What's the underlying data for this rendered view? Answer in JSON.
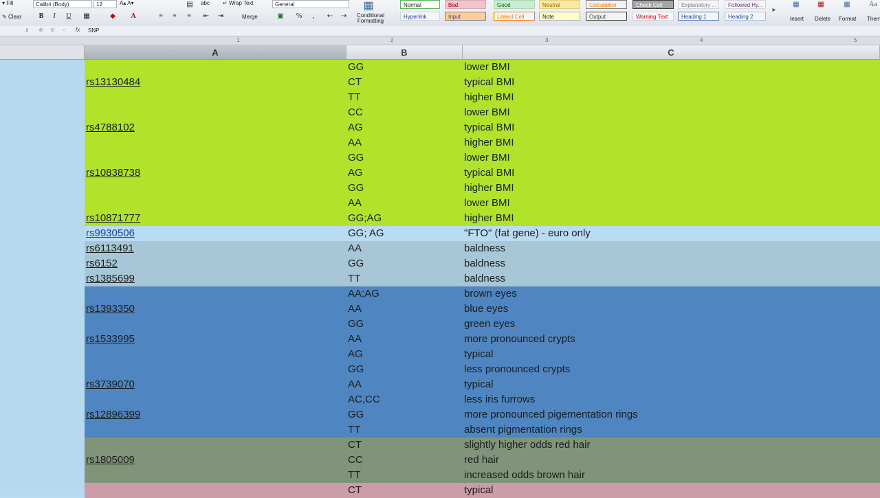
{
  "ribbon": {
    "fill_label": "Fill",
    "clear_label": "Clear",
    "font_name": "Calibri (Body)",
    "font_size": "12",
    "bold": "B",
    "italic": "I",
    "underline": "U",
    "wrap_text": "Wrap Text",
    "abc": "abc",
    "merge": "Merge",
    "number_format": "General",
    "percent": "%",
    "comma": ",",
    "conditional_formatting": "Conditional Formatting",
    "styles": [
      {
        "label": "Normal",
        "bg": "#ffffff",
        "fg": "#222222",
        "border": "#5ab55a"
      },
      {
        "label": "Bad",
        "bg": "#f2c4ce",
        "fg": "#9c0006",
        "border": "#d8a7b1"
      },
      {
        "label": "Good",
        "bg": "#c8eecf",
        "fg": "#006100",
        "border": "#a7d6b0"
      },
      {
        "label": "Neutral",
        "bg": "#fbeaa2",
        "fg": "#9c6500",
        "border": "#dfcf8a"
      },
      {
        "label": "Calculation",
        "bg": "#f2f2f2",
        "fg": "#fa7d00",
        "border": "#7f7f7f"
      },
      {
        "label": "Check Cell",
        "bg": "#a5a5a5",
        "fg": "#ffffff",
        "border": "#3f3f3f"
      },
      {
        "label": "Explanatory ...",
        "bg": "#f4f6f9",
        "fg": "#7f7f7f",
        "border": "#d0d5db"
      },
      {
        "label": "Followed Hy...",
        "bg": "#f4f6f9",
        "fg": "#7b2a90",
        "border": "#d0d5db"
      },
      {
        "label": "Hyperlink",
        "bg": "#f4f6f9",
        "fg": "#1f3bb8",
        "border": "#d0d5db"
      },
      {
        "label": "Input",
        "bg": "#ffcc99",
        "fg": "#3f3f76",
        "border": "#7f7f7f"
      },
      {
        "label": "Linked Cell",
        "bg": "#f4f6f9",
        "fg": "#fa7d00",
        "border": "#fa7d00"
      },
      {
        "label": "Note",
        "bg": "#ffffcc",
        "fg": "#222222",
        "border": "#b2b2b2"
      },
      {
        "label": "Output",
        "bg": "#f2f2f2",
        "fg": "#3f3f3f",
        "border": "#3f3f3f"
      },
      {
        "label": "Warning Text",
        "bg": "#f4f6f9",
        "fg": "#ff0000",
        "border": "#d0d5db"
      },
      {
        "label": "Heading 1",
        "bg": "#f4f6f9",
        "fg": "#1f497d",
        "border": "#4f81bd"
      },
      {
        "label": "Heading 2",
        "bg": "#f4f6f9",
        "fg": "#1f497d",
        "border": "#a7bfde"
      }
    ],
    "insert": "Insert",
    "delete": "Delete",
    "format": "Format",
    "themes": "Them"
  },
  "formula_bar": {
    "fx": "fx",
    "value": "SNP"
  },
  "ruler_marks": [
    "1",
    "2",
    "3",
    "4",
    "5"
  ],
  "columns": [
    "A",
    "B",
    "C"
  ],
  "rows": [
    {
      "a": "",
      "b": "GG",
      "c": "lower BMI",
      "bg": "#b2e32b"
    },
    {
      "a": "rs13130484",
      "b": "CT",
      "c": "typical BMI",
      "bg": "#b2e32b"
    },
    {
      "a": "",
      "b": "TT",
      "c": "higher BMI",
      "bg": "#b2e32b"
    },
    {
      "a": "",
      "b": "CC",
      "c": "lower BMI",
      "bg": "#b2e32b"
    },
    {
      "a": "rs4788102",
      "b": "AG",
      "c": "typical BMI",
      "bg": "#b2e32b"
    },
    {
      "a": "",
      "b": "AA",
      "c": "higher BMI",
      "bg": "#b2e32b"
    },
    {
      "a": "",
      "b": "GG",
      "c": "lower BMI",
      "bg": "#b2e32b"
    },
    {
      "a": "rs10838738",
      "b": "AG",
      "c": "typical BMI",
      "bg": "#b2e32b"
    },
    {
      "a": "",
      "b": "GG",
      "c": "higher BMI",
      "bg": "#b2e32b"
    },
    {
      "a": "",
      "b": "AA",
      "c": "lower BMI",
      "bg": "#b2e32b"
    },
    {
      "a": "rs10871777",
      "b": "GG;AG",
      "c": "higher BMI",
      "bg": "#b2e32b"
    },
    {
      "a": "rs9930506",
      "b": "GG; AG",
      "c": "\"FTO\" (fat gene) - euro only",
      "bg": "#b9dcf2",
      "link": true
    },
    {
      "a": "rs6113491",
      "b": "AA",
      "c": "baldness",
      "bg": "#a8c7d6"
    },
    {
      "a": "rs6152",
      "b": "GG",
      "c": "baldness",
      "bg": "#a8c7d6"
    },
    {
      "a": "rs1385699",
      "b": "TT",
      "c": "baldness",
      "bg": "#a8c7d6"
    },
    {
      "a": "",
      "b": "AA;AG",
      "c": "brown eyes",
      "bg": "#4f86c2"
    },
    {
      "a": "rs1393350",
      "b": "AA",
      "c": "blue eyes",
      "bg": "#4f86c2"
    },
    {
      "a": "",
      "b": "GG",
      "c": "green eyes",
      "bg": "#4f86c2"
    },
    {
      "a": "rs1533995",
      "b": "AA",
      "c": "more pronounced crypts",
      "bg": "#4f86c2"
    },
    {
      "a": "",
      "b": "AG",
      "c": "typical",
      "bg": "#4f86c2"
    },
    {
      "a": "",
      "b": "GG",
      "c": "less pronounced crypts",
      "bg": "#4f86c2"
    },
    {
      "a": "rs3739070",
      "b": "AA",
      "c": "typical",
      "bg": "#4f86c2"
    },
    {
      "a": "",
      "b": "AC,CC",
      "c": "less iris furrows",
      "bg": "#4f86c2"
    },
    {
      "a": "rs12896399",
      "b": "GG",
      "c": "more pronounced pigementation rings",
      "bg": "#4f86c2"
    },
    {
      "a": "",
      "b": "TT",
      "c": "absent pigmentation rings",
      "bg": "#4f86c2"
    },
    {
      "a": "",
      "b": "CT",
      "c": "slightly higher odds red hair",
      "bg": "#7f9478"
    },
    {
      "a": "rs1805009",
      "b": "CC",
      "c": "red hair",
      "bg": "#7f9478"
    },
    {
      "a": "",
      "b": "TT",
      "c": "increased odds brown hair",
      "bg": "#7f9478"
    },
    {
      "a": "",
      "b": "CT",
      "c": "typical",
      "bg": "#cc9cab"
    }
  ]
}
